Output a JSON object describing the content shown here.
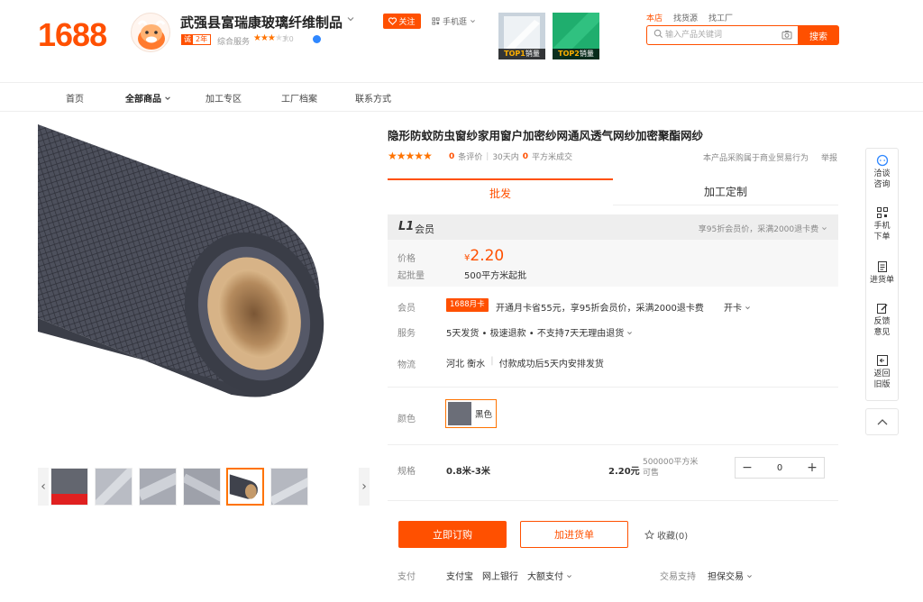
{
  "header": {
    "logo": "1688",
    "shop_name": "武强县富瑞康玻璃纤维制品",
    "year_badge_icon": "诚",
    "year_badge": "2年",
    "rating_label": "综合服务",
    "rating_stars": 3,
    "rating_value": "3.0",
    "follow_label": "关注",
    "phone_shop_label": "手机逛",
    "top_products": [
      {
        "rank": "TOP1",
        "label": "销量",
        "color": "#e9edf1"
      },
      {
        "rank": "TOP2",
        "label": "销量",
        "color": "#1fae6e"
      }
    ],
    "search_tabs": [
      "本店",
      "找货源",
      "找工厂"
    ],
    "search_placeholder": "输入产品关键词",
    "search_button": "搜索"
  },
  "nav": {
    "items": [
      "首页",
      "全部商品",
      "加工专区",
      "工厂档案",
      "联系方式"
    ]
  },
  "gallery": {
    "thumb_count": 6,
    "selected_index": 4
  },
  "product": {
    "title": "隐形防蚊防虫窗纱家用窗户加密纱网通风透气网纱加密聚酯网纱",
    "review_count": "0",
    "review_label": "条评价",
    "period_label": "30天内",
    "sold_count": "0",
    "sold_label": "平方米成交",
    "purchase_note": "本产品采购属于商业贸易行为",
    "report_label": "举报",
    "tabs": [
      "批发",
      "加工定制"
    ],
    "member_level": "L1",
    "member_label": "会员",
    "member_right": "享95折会员价，采满2000退卡费",
    "price_label": "价格",
    "currency": "¥",
    "price": "2.20",
    "moq_label": "起批量",
    "moq_value": "500平方米起批",
    "member_row_label": "会员",
    "card_badge": "1688月卡",
    "member_text": "开通月卡省55元，享95折会员价，采满2000退卡费",
    "open_card": "开卡",
    "service_label": "服务",
    "service_text": "5天发货 • 极速退款 • 不支持7天无理由退货",
    "logistics_label": "物流",
    "logistics_from": "河北 衡水",
    "logistics_note": "付款成功后5天内安排发货",
    "color_label": "颜色",
    "color_option": "黑色",
    "spec_label": "规格",
    "spec_value": "0.8米-3米",
    "spec_price": "2.20元",
    "stock_line1": "500000平方米",
    "stock_line2": "可售",
    "qty_value": "0",
    "buy_button": "立即订购",
    "cart_button": "加进货单",
    "favorite": "收藏(0)",
    "pay_label": "支付",
    "pay_methods": [
      "支付宝",
      "网上银行",
      "大额支付"
    ],
    "trade_label": "交易支持",
    "trade_value": "担保交易"
  },
  "sidebar": {
    "items": [
      "洽谈\n咨询",
      "手机\n下单",
      "进货单",
      "反馈\n意见",
      "返回\n旧版"
    ]
  },
  "colors": {
    "accent": "#ff5000",
    "star": "#ff7300"
  }
}
